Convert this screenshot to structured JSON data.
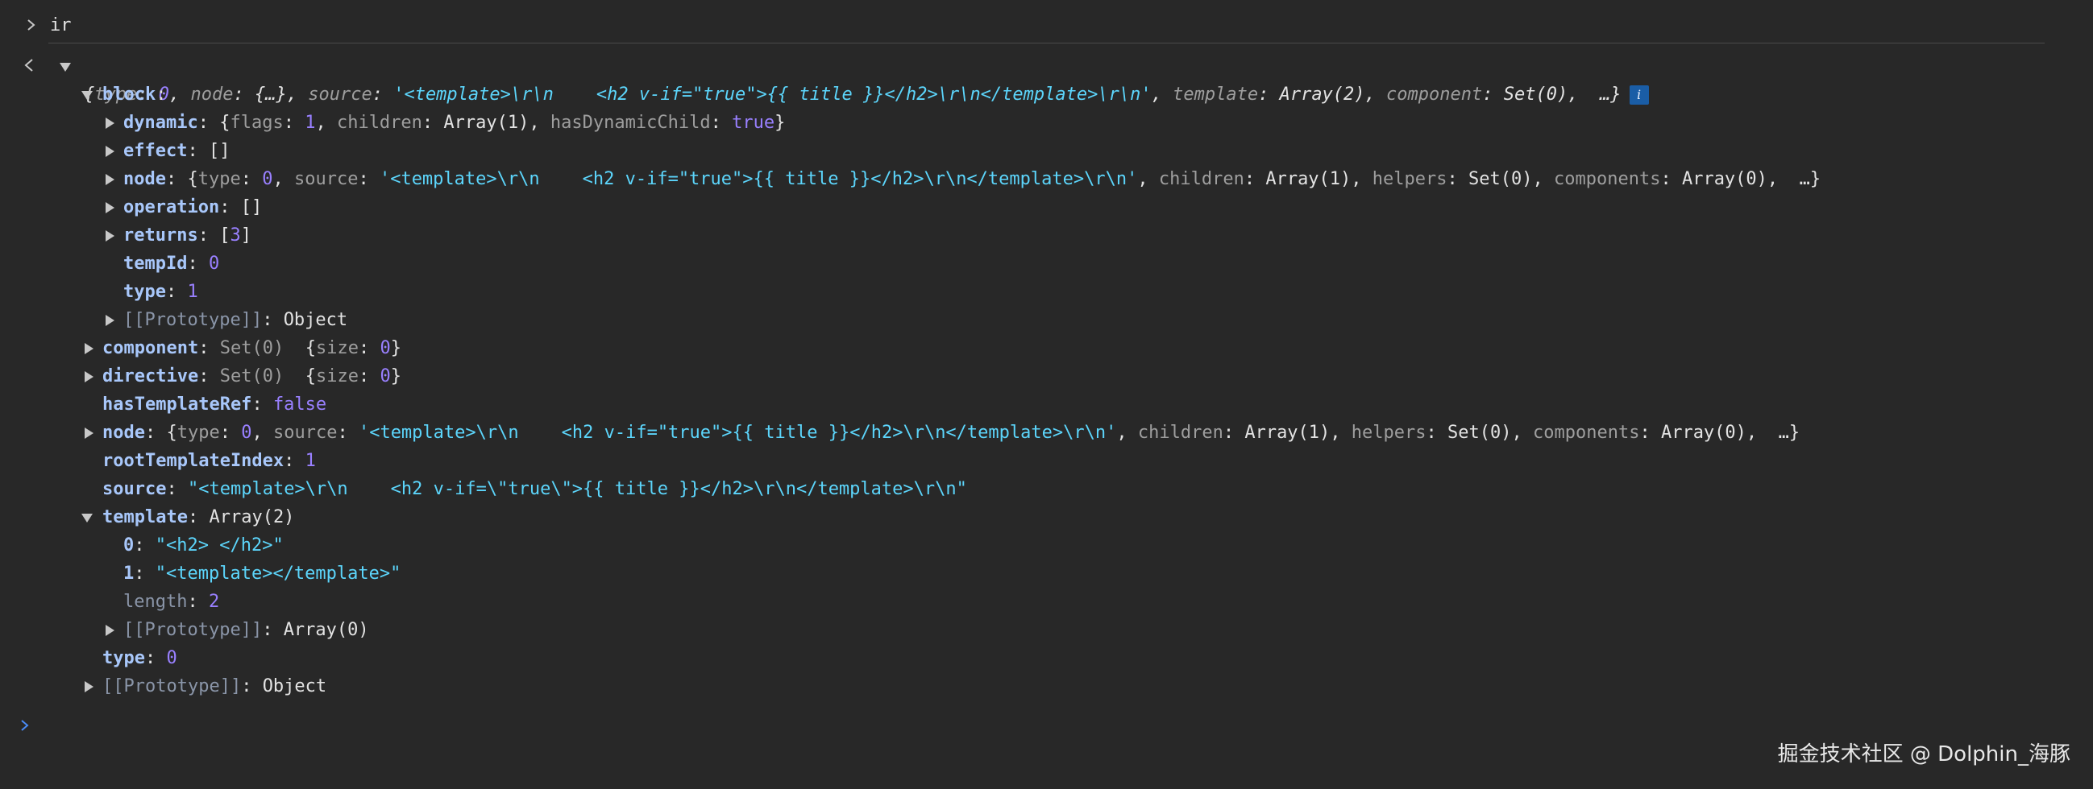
{
  "console": {
    "input_command": "ir",
    "result_preview": {
      "open_brace": "{",
      "k_type": "type",
      "v_type": "0",
      "k_node": "node",
      "v_node": "{…}",
      "k_source": "source",
      "v_source": "'<template>\\r\\n    <h2 v-if=\"true\">{{ title }}</h2>\\r\\n</template>\\r\\n'",
      "k_template": "template",
      "v_template": "Array(2)",
      "k_component": "component",
      "v_component": "Set(0)",
      "ellipsis": "…}",
      "info": "i"
    },
    "tree": {
      "block": {
        "key": "block",
        "dynamic": {
          "key": "dynamic",
          "k_flags": "flags",
          "v_flags": "1",
          "k_children": "children",
          "v_children": "Array(1)",
          "k_hdc": "hasDynamicChild",
          "v_hdc": "true"
        },
        "effect": {
          "key": "effect",
          "value": "[]"
        },
        "node": {
          "key": "node",
          "k_type": "type",
          "v_type": "0",
          "k_source": "source",
          "v_source": "'<template>\\r\\n    <h2 v-if=\"true\">{{ title }}</h2>\\r\\n</template>\\r\\n'",
          "k_children": "children",
          "v_children": "Array(1)",
          "k_helpers": "helpers",
          "v_helpers": "Set(0)",
          "k_components": "components",
          "v_components": "Array(0)",
          "ellipsis": "…}"
        },
        "operation": {
          "key": "operation",
          "value": "[]"
        },
        "returns": {
          "key": "returns",
          "open": "[",
          "value": "3",
          "close": "]"
        },
        "tempId": {
          "key": "tempId",
          "value": "0"
        },
        "type": {
          "key": "type",
          "value": "1"
        },
        "prototype": {
          "key": "[[Prototype]]",
          "value": "Object"
        }
      },
      "component": {
        "key": "component",
        "value": "Set(0)",
        "k_size": "size",
        "v_size": "0"
      },
      "directive": {
        "key": "directive",
        "value": "Set(0)",
        "k_size": "size",
        "v_size": "0"
      },
      "hasTemplateRef": {
        "key": "hasTemplateRef",
        "value": "false"
      },
      "node": {
        "key": "node",
        "k_type": "type",
        "v_type": "0",
        "k_source": "source",
        "v_source": "'<template>\\r\\n    <h2 v-if=\"true\">{{ title }}</h2>\\r\\n</template>\\r\\n'",
        "k_children": "children",
        "v_children": "Array(1)",
        "k_helpers": "helpers",
        "v_helpers": "Set(0)",
        "k_components": "components",
        "v_components": "Array(0)",
        "ellipsis": "…}"
      },
      "rootTemplateIndex": {
        "key": "rootTemplateIndex",
        "value": "1"
      },
      "source": {
        "key": "source",
        "value": "\"<template>\\r\\n    <h2 v-if=\\\"true\\\">{{ title }}</h2>\\r\\n</template>\\r\\n\""
      },
      "template": {
        "key": "template",
        "value": "Array(2)",
        "item0": {
          "key": "0",
          "value": "\"<h2> </h2>\""
        },
        "item1": {
          "key": "1",
          "value": "\"<template></template>\""
        },
        "length": {
          "key": "length",
          "value": "2"
        },
        "prototype": {
          "key": "[[Prototype]]",
          "value": "Array(0)"
        }
      },
      "type": {
        "key": "type",
        "value": "0"
      },
      "prototype": {
        "key": "[[Prototype]]",
        "value": "Object"
      }
    }
  },
  "watermark": "掘金技术社区 @ Dolphin_海豚",
  "colors": {
    "background": "#282828",
    "key": "#a8c7fa",
    "number": "#9980ff",
    "string": "#5cd5fb",
    "prompt": "#4a8cf7"
  }
}
